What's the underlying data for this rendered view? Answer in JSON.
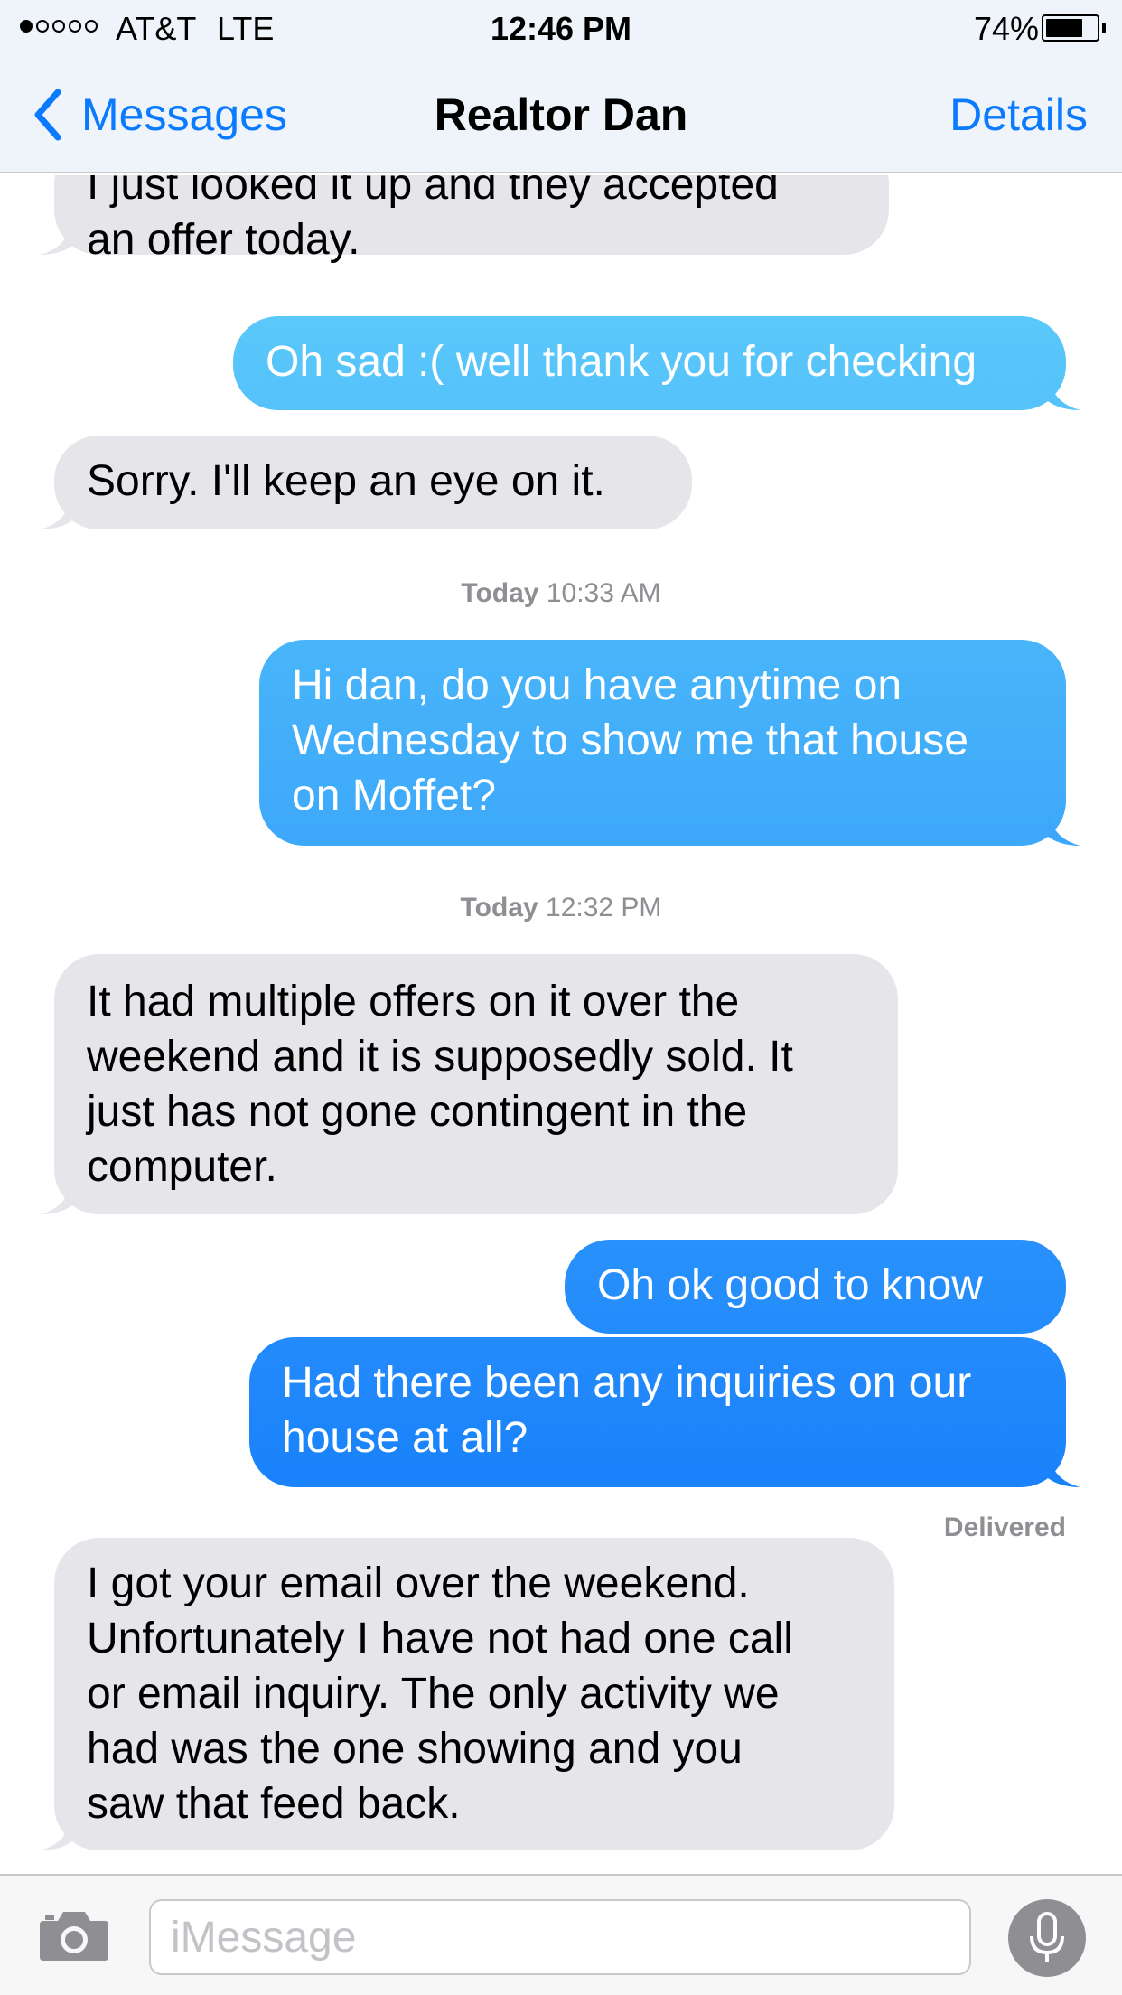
{
  "status_bar": {
    "signal_bars_filled": 1,
    "signal_bars_total": 5,
    "carrier": "AT&T",
    "network": "LTE",
    "time": "12:46 PM",
    "battery_percent": "74%",
    "battery_level": 0.74
  },
  "nav": {
    "back_label": "Messages",
    "title": "Realtor Dan",
    "details_label": "Details",
    "accent_color": "#0a7aff"
  },
  "colors": {
    "incoming_bubble": "#e5e5ea",
    "outgoing_top": "#5ac8fa",
    "outgoing_bottom": "#1a82fb",
    "meta_text": "#8e8e93"
  },
  "messages": [
    {
      "sender": "contact",
      "text": "I just looked it up and they accepted\nan offer today."
    },
    {
      "sender": "me",
      "text": "Oh sad :( well thank you for checking"
    },
    {
      "sender": "contact",
      "text": "Sorry. I'll keep an eye on it."
    },
    {
      "type": "timestamp",
      "day": "Today",
      "time": "10:33 AM"
    },
    {
      "sender": "me",
      "text": "Hi dan, do you have anytime on\nWednesday to show me that house\non Moffet?"
    },
    {
      "type": "timestamp",
      "day": "Today",
      "time": "12:32 PM"
    },
    {
      "sender": "contact",
      "text": "It had multiple offers on it over the\nweekend and it is supposedly sold. It\njust has not gone contingent in the\ncomputer."
    },
    {
      "sender": "me",
      "text": "Oh ok good to know"
    },
    {
      "sender": "me",
      "text": "Had there been any inquiries on our\nhouse at all?"
    },
    {
      "type": "status",
      "text": "Delivered"
    },
    {
      "sender": "contact",
      "text": "I got your email over the weekend.\nUnfortunately I have not had one call\nor email inquiry. The only activity we\nhad was the one showing and you\nsaw that feed back."
    }
  ],
  "input": {
    "placeholder": "iMessage",
    "camera_icon": "camera-icon",
    "mic_icon": "microphone-icon"
  }
}
